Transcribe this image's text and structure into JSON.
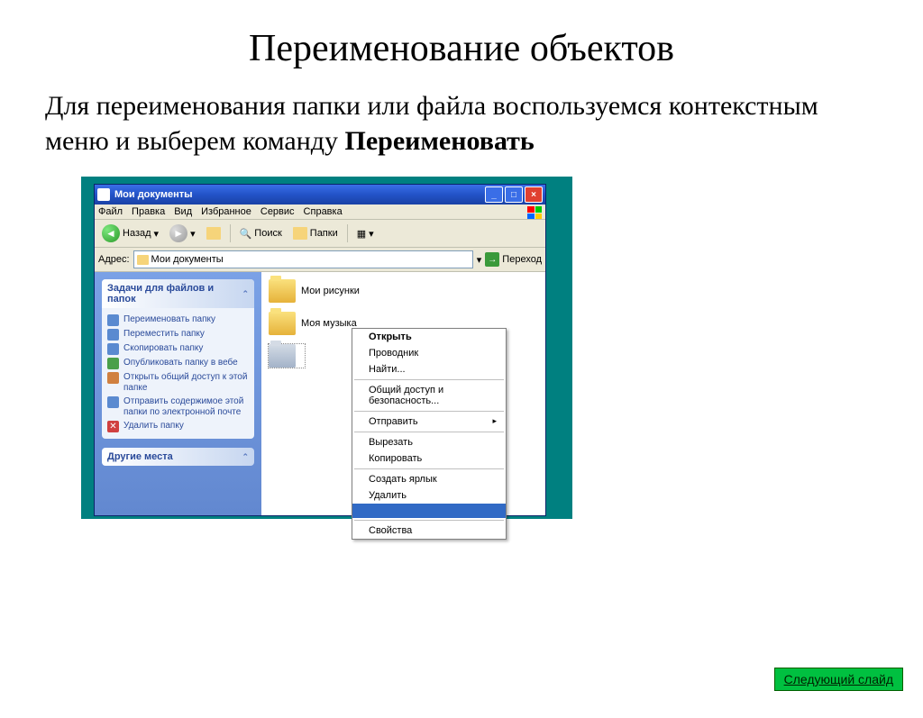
{
  "slide": {
    "title": "Переименование объектов",
    "body_part1": "Для переименования папки или файла воспользуемся контекстным меню и выберем команду ",
    "body_bold": "Переименовать",
    "next_button": "Следующий слайд"
  },
  "window": {
    "title": "Мои документы",
    "menu": [
      "Файл",
      "Правка",
      "Вид",
      "Избранное",
      "Сервис",
      "Справка"
    ],
    "toolbar": {
      "back": "Назад",
      "search": "Поиск",
      "folders": "Папки"
    },
    "address_label": "Адрес:",
    "address_value": "Мои документы",
    "go": "Переход",
    "sidebar": {
      "panel1_title": "Задачи для файлов и папок",
      "tasks": [
        "Переименовать папку",
        "Переместить папку",
        "Скопировать папку",
        "Опубликовать папку в вебе",
        "Открыть общий доступ к этой папке",
        "Отправить содержимое этой папки по электронной почте",
        "Удалить папку"
      ],
      "panel2_title": "Другие места"
    },
    "items": [
      "Мои рисунки",
      "Моя музыка"
    ]
  },
  "context_menu": {
    "open": "Открыть",
    "explorer": "Проводник",
    "find": "Найти...",
    "share": "Общий доступ и безопасность...",
    "sendto": "Отправить",
    "cut": "Вырезать",
    "copy": "Копировать",
    "shortcut": "Создать ярлык",
    "delete": "Удалить",
    "properties": "Свойства"
  }
}
